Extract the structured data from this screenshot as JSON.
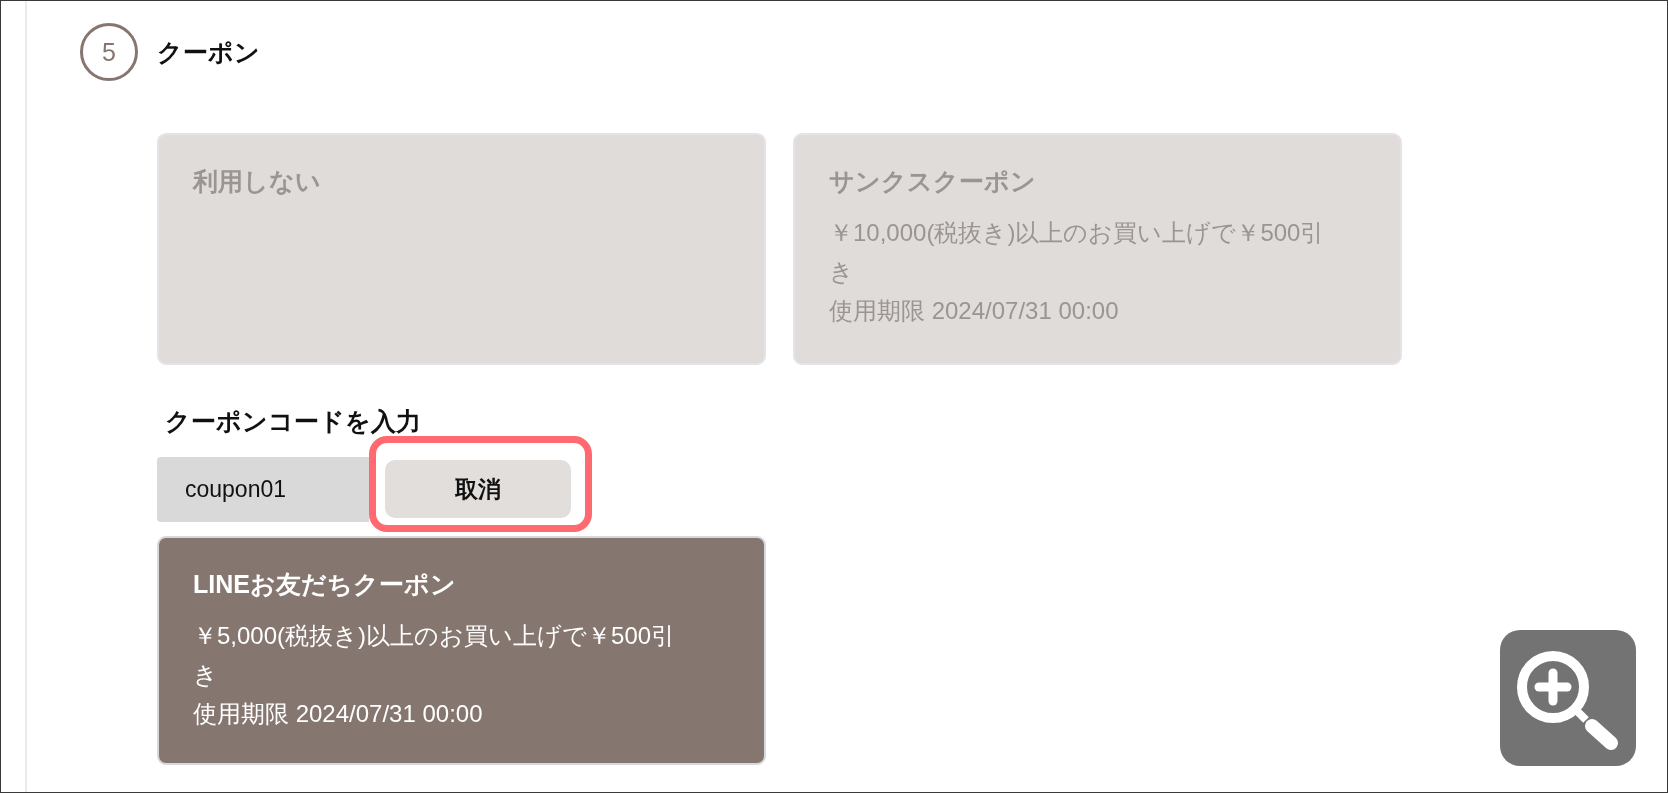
{
  "section": {
    "number": "5",
    "title": "クーポン"
  },
  "coupons": [
    {
      "title": "利用しない",
      "selected": false
    },
    {
      "title": "サンクスクーポン",
      "description": "￥10,000(税抜き)以上のお買い上げで￥500引き",
      "expiry": "使用期限 2024/07/31 00:00",
      "selected": false
    }
  ],
  "code_entry": {
    "label": "クーポンコードを入力",
    "value": "coupon01",
    "button": {
      "label": "取消",
      "highlighted": true
    }
  },
  "applied_coupons": [
    {
      "title": "LINEお友だちクーポン",
      "description": "￥5,000(税抜き)以上のお買い上げで￥500引き",
      "expiry": "使用期限 2024/07/31 00:00",
      "selected": true
    }
  ]
}
